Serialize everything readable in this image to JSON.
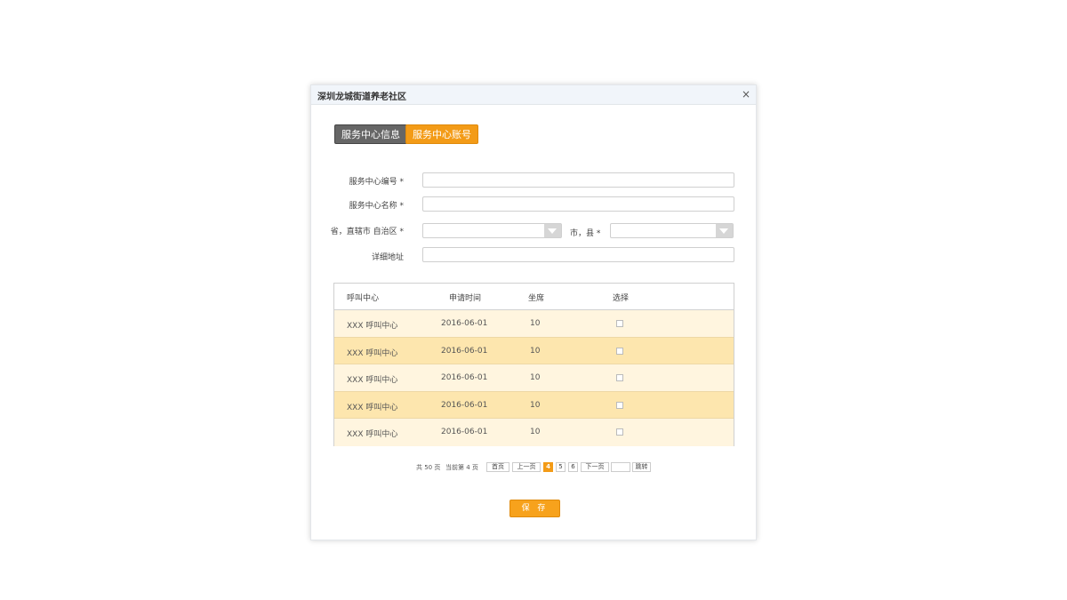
{
  "dialog": {
    "title": "深圳龙城街道养老社区",
    "close": "×"
  },
  "tabs": [
    {
      "label": "服务中心信息"
    },
    {
      "label": "服务中心账号"
    }
  ],
  "form": {
    "code_label": "服务中心编号 *",
    "name_label": "服务中心名称 *",
    "province_label": "省，直辖市 自治区 *",
    "city_label": "市，县 *",
    "address_label": "详细地址",
    "code_value": "",
    "name_value": "",
    "address_value": ""
  },
  "table": {
    "headers": [
      "呼叫中心",
      "申请时间",
      "坐席",
      "选择"
    ],
    "rows": [
      {
        "center": "XXX 呼叫中心",
        "time": "2016-06-01",
        "seats": "10"
      },
      {
        "center": "XXX 呼叫中心",
        "time": "2016-06-01",
        "seats": "10"
      },
      {
        "center": "XXX 呼叫中心",
        "time": "2016-06-01",
        "seats": "10"
      },
      {
        "center": "XXX 呼叫中心",
        "time": "2016-06-01",
        "seats": "10"
      },
      {
        "center": "XXX 呼叫中心",
        "time": "2016-06-01",
        "seats": "10"
      }
    ]
  },
  "pager": {
    "total": "共 50 页",
    "current": "当前第 4 页",
    "first": "首页",
    "prev": "上一页",
    "pages": [
      "4",
      "5",
      "6"
    ],
    "active_page": "4",
    "next": "下一页",
    "jump": "跳转"
  },
  "save_label": "保 存",
  "colors": {
    "accent": "#f39b17",
    "row_light": "#fff5df",
    "row_dark": "#fde6ae",
    "tab_inactive": "#666666"
  }
}
